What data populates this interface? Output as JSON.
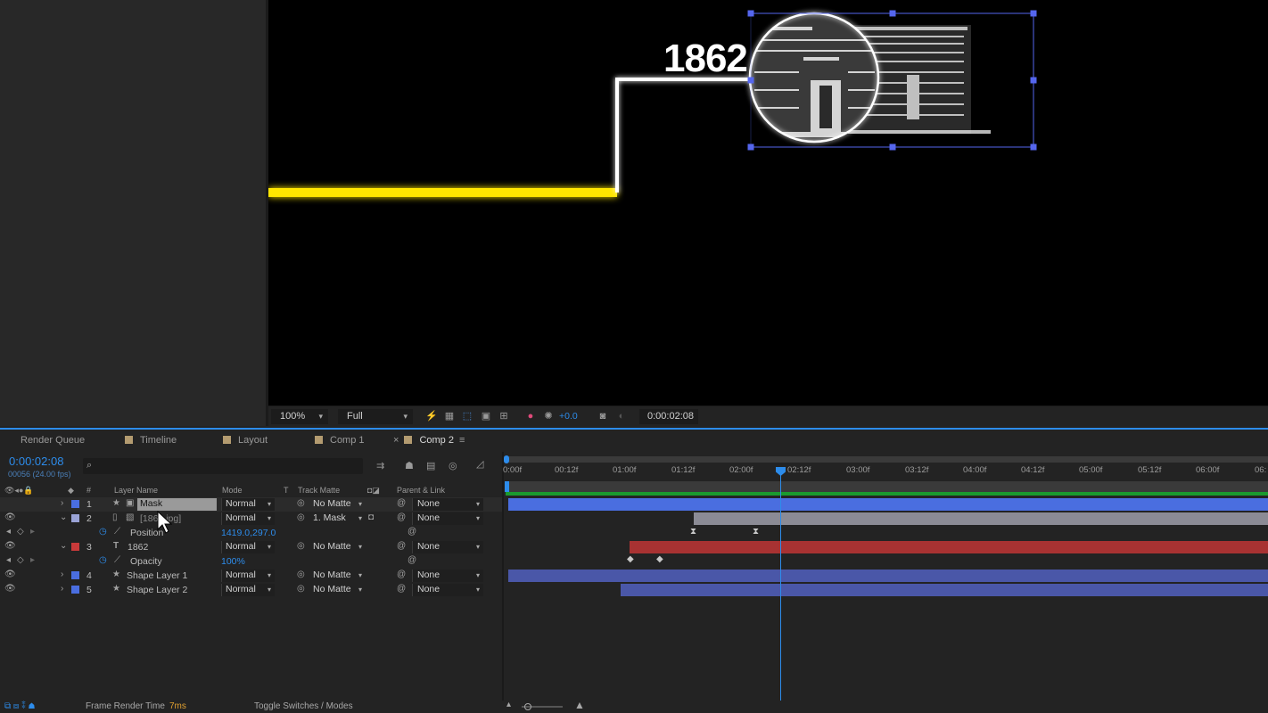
{
  "viewer": {
    "headline": "1862",
    "zoom": "100%",
    "resolution": "Full",
    "exposure": "+0.0",
    "timecode": "0:00:02:08"
  },
  "tabs": [
    {
      "label": "Render Queue"
    },
    {
      "label": "Timeline"
    },
    {
      "label": "Layout"
    },
    {
      "label": "Comp 1"
    },
    {
      "label": "Comp 2",
      "active": true
    }
  ],
  "timeline": {
    "current_time": "0:00:02:08",
    "frame_info": "00056 (24.00 fps)",
    "search_placeholder": "",
    "columns": {
      "number": "#",
      "layer_name": "Layer Name",
      "mode": "Mode",
      "t": "T",
      "track_matte": "Track Matte",
      "parent": "Parent & Link"
    },
    "layers": [
      {
        "num": "1",
        "name": "Mask",
        "mode": "Normal",
        "matte": "No Matte",
        "parent": "None",
        "color": "#4a6ee0"
      },
      {
        "num": "2",
        "name": "[186_.jpg]",
        "mode": "Normal",
        "matte": "1. Mask",
        "parent": "None",
        "color": "#9aa3d6"
      },
      {
        "num": "3",
        "name": "1862",
        "mode": "Normal",
        "matte": "No Matte",
        "parent": "None",
        "color": "#c93a3a"
      },
      {
        "num": "4",
        "name": "Shape Layer 1",
        "mode": "Normal",
        "matte": "No Matte",
        "parent": "None",
        "color": "#4a6ee0"
      },
      {
        "num": "5",
        "name": "Shape Layer 2",
        "mode": "Normal",
        "matte": "No Matte",
        "parent": "None",
        "color": "#4a6ee0"
      }
    ],
    "properties": [
      {
        "name": "Position",
        "value": "1419.0,297.0"
      },
      {
        "name": "Opacity",
        "value": "100%"
      }
    ],
    "ruler_ticks": [
      "0:00f",
      "00:12f",
      "01:00f",
      "01:12f",
      "02:00f",
      "02:12f",
      "03:00f",
      "03:12f",
      "04:00f",
      "04:12f",
      "05:00f",
      "05:12f",
      "06:00f",
      "06:"
    ]
  },
  "status": {
    "render_label": "Frame Render Time",
    "render_value": "7ms",
    "toggle": "Toggle Switches / Modes"
  },
  "colors": {
    "accent": "#2d8ceb",
    "yellow_line": "#ffe600"
  }
}
